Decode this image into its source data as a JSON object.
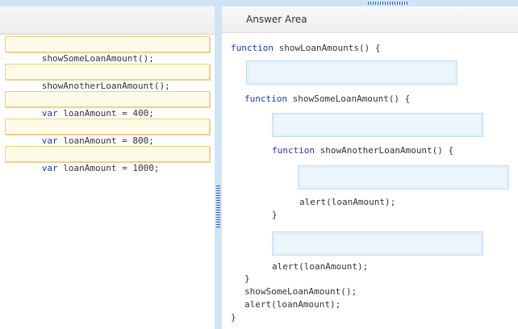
{
  "left_tiles": [
    {
      "keyword": "",
      "text": "showSomeLoanAmount();"
    },
    {
      "keyword": "",
      "text": "showAnotherLoanAmount();"
    },
    {
      "keyword": "var",
      "text": " loanAmount = 400;"
    },
    {
      "keyword": "var",
      "text": " loanAmount = 800;"
    },
    {
      "keyword": "var",
      "text": " loanAmount = 1000;"
    }
  ],
  "answer_area": {
    "title": "Answer Area",
    "lines": {
      "fn1_kw": "function",
      "fn1_rest": " showLoanAmounts() {",
      "fn2_kw": "function",
      "fn2_rest": " showSomeLoanAmount() {",
      "fn3_kw": "function",
      "fn3_rest": " showAnotherLoanAmount() {",
      "alert_inner": "alert(loanAmount);",
      "close_inner": "}",
      "alert_middle": "alert(loanAmount);",
      "close_middle": "}",
      "call_some": "showSomeLoanAmount();",
      "alert_outer": "alert(loanAmount);",
      "close_outer": "}"
    }
  },
  "colors": {
    "keyword": "#1c38b8",
    "tile_bg": "#fffbe6",
    "tile_border": "#f0cf78",
    "drop_bg": "#eef6fd",
    "panel_accent": "#cfe4f7"
  }
}
